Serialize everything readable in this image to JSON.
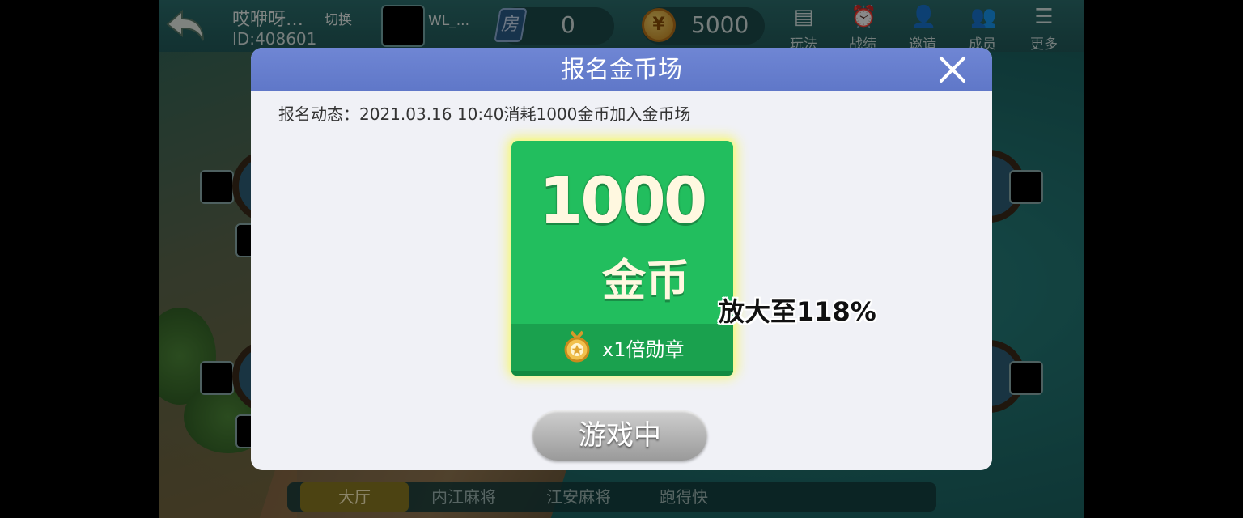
{
  "topbar": {
    "club_name": "哎咿呀…",
    "switch_label": "切换",
    "club_id": "ID:408601",
    "user_name": "WL_...",
    "room_icon_glyph": "房",
    "room_cards": "0",
    "coins": "5000",
    "menu": [
      {
        "icon": "rules-icon",
        "label": "玩法"
      },
      {
        "icon": "record-icon",
        "label": "战绩"
      },
      {
        "icon": "invite-icon",
        "label": "邀请"
      },
      {
        "icon": "members-icon",
        "label": "成员"
      },
      {
        "icon": "more-icon",
        "label": "更多"
      }
    ]
  },
  "bottom_tabs": [
    "大厅",
    "内江麻将",
    "江安麻将",
    "跑得快"
  ],
  "dialog": {
    "title": "报名金币场",
    "status_text": "报名动态：2021.03.16  10:40消耗1000金币加入金币场",
    "card": {
      "amount": "1000",
      "unit": "金币",
      "badge_text": "x1倍勋章"
    },
    "zoom_text": "放大至118%",
    "play_button": "游戏中"
  },
  "colors": {
    "dialog_header": "#6f86d4",
    "card_green": "#22be5e",
    "card_glow": "#f5f58a",
    "play_button": "#b4b4b4"
  }
}
